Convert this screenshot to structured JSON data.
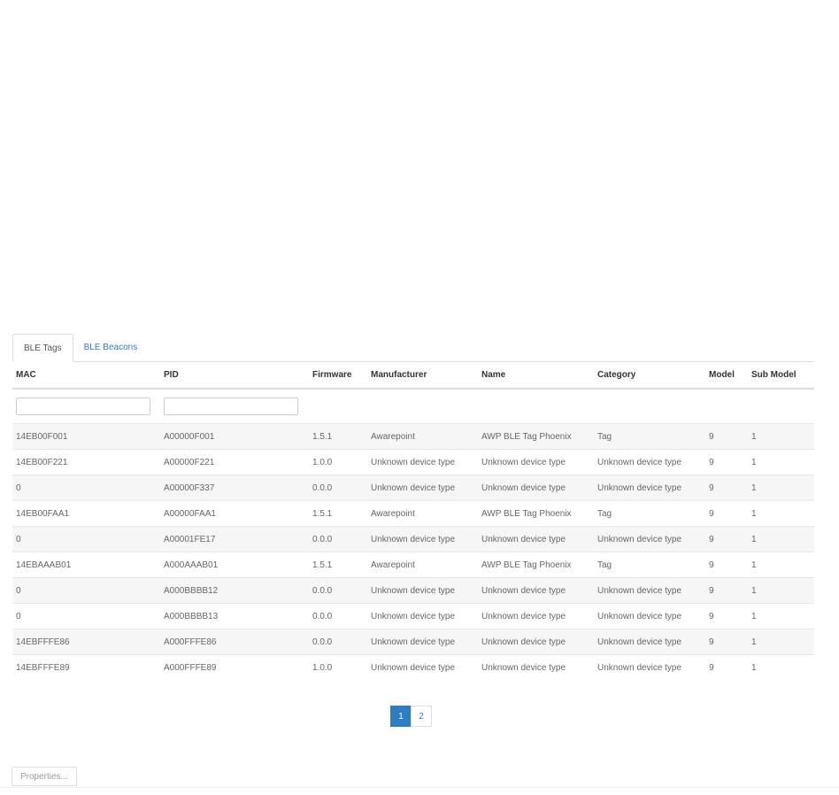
{
  "tabs": [
    {
      "label": "BLE Tags"
    },
    {
      "label": "BLE Beacons"
    }
  ],
  "columns": [
    "MAC",
    "PID",
    "Firmware",
    "Manufacturer",
    "Name",
    "Category",
    "Model",
    "Sub Model"
  ],
  "rows": [
    [
      "14EB00F001",
      "A00000F001",
      "1.5.1",
      "Awarepoint",
      "AWP BLE Tag Phoenix",
      "Tag",
      "9",
      "1"
    ],
    [
      "14EB00F221",
      "A00000F221",
      "1.0.0",
      "Unknown device type",
      "Unknown device type",
      "Unknown device type",
      "9",
      "1"
    ],
    [
      "0",
      "A00000F337",
      "0.0.0",
      "Unknown device type",
      "Unknown device type",
      "Unknown device type",
      "9",
      "1"
    ],
    [
      "14EB00FAA1",
      "A00000FAA1",
      "1.5.1",
      "Awarepoint",
      "AWP BLE Tag Phoenix",
      "Tag",
      "9",
      "1"
    ],
    [
      "0",
      "A00001FE17",
      "0.0.0",
      "Unknown device type",
      "Unknown device type",
      "Unknown device type",
      "9",
      "1"
    ],
    [
      "14EBAAAB01",
      "A000AAAB01",
      "1.5.1",
      "Awarepoint",
      "AWP BLE Tag Phoenix",
      "Tag",
      "9",
      "1"
    ],
    [
      "0",
      "A000BBBB12",
      "0.0.0",
      "Unknown device type",
      "Unknown device type",
      "Unknown device type",
      "9",
      "1"
    ],
    [
      "0",
      "A000BBBB13",
      "0.0.0",
      "Unknown device type",
      "Unknown device type",
      "Unknown device type",
      "9",
      "1"
    ],
    [
      "14EBFFFE86",
      "A000FFFE86",
      "0.0.0",
      "Unknown device type",
      "Unknown device type",
      "Unknown device type",
      "9",
      "1"
    ],
    [
      "14EBFFFE89",
      "A000FFFE89",
      "1.0.0",
      "Unknown device type",
      "Unknown device type",
      "Unknown device type",
      "9",
      "1"
    ]
  ],
  "pagination": {
    "pages": [
      "1",
      "2"
    ],
    "current": "1"
  },
  "properties_button": {
    "label": "Properties..."
  }
}
